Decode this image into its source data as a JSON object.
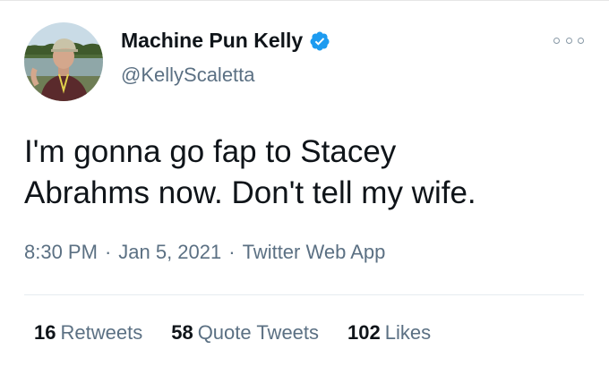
{
  "author": {
    "display_name": "Machine Pun Kelly",
    "handle": "@KellyScaletta",
    "verified": true,
    "avatar_icon": "profile-photo-icon",
    "verified_color": "#1d9bf0"
  },
  "tweet": {
    "text": "I'm gonna go fap to Stacey\nAbrahms now. Don't tell my wife.",
    "time": "8:30 PM",
    "date": "Jan 5, 2021",
    "source": "Twitter Web App",
    "separator": "·"
  },
  "stats": {
    "retweets_count": "16",
    "retweets_label": "Retweets",
    "quote_tweets_count": "58",
    "quote_tweets_label": "Quote Tweets",
    "likes_count": "102",
    "likes_label": "Likes"
  },
  "menu": {
    "icon": "more-options-icon"
  },
  "colors": {
    "text_primary": "#0f1419",
    "text_secondary": "#5b7083",
    "divider": "#e6ecf0"
  }
}
